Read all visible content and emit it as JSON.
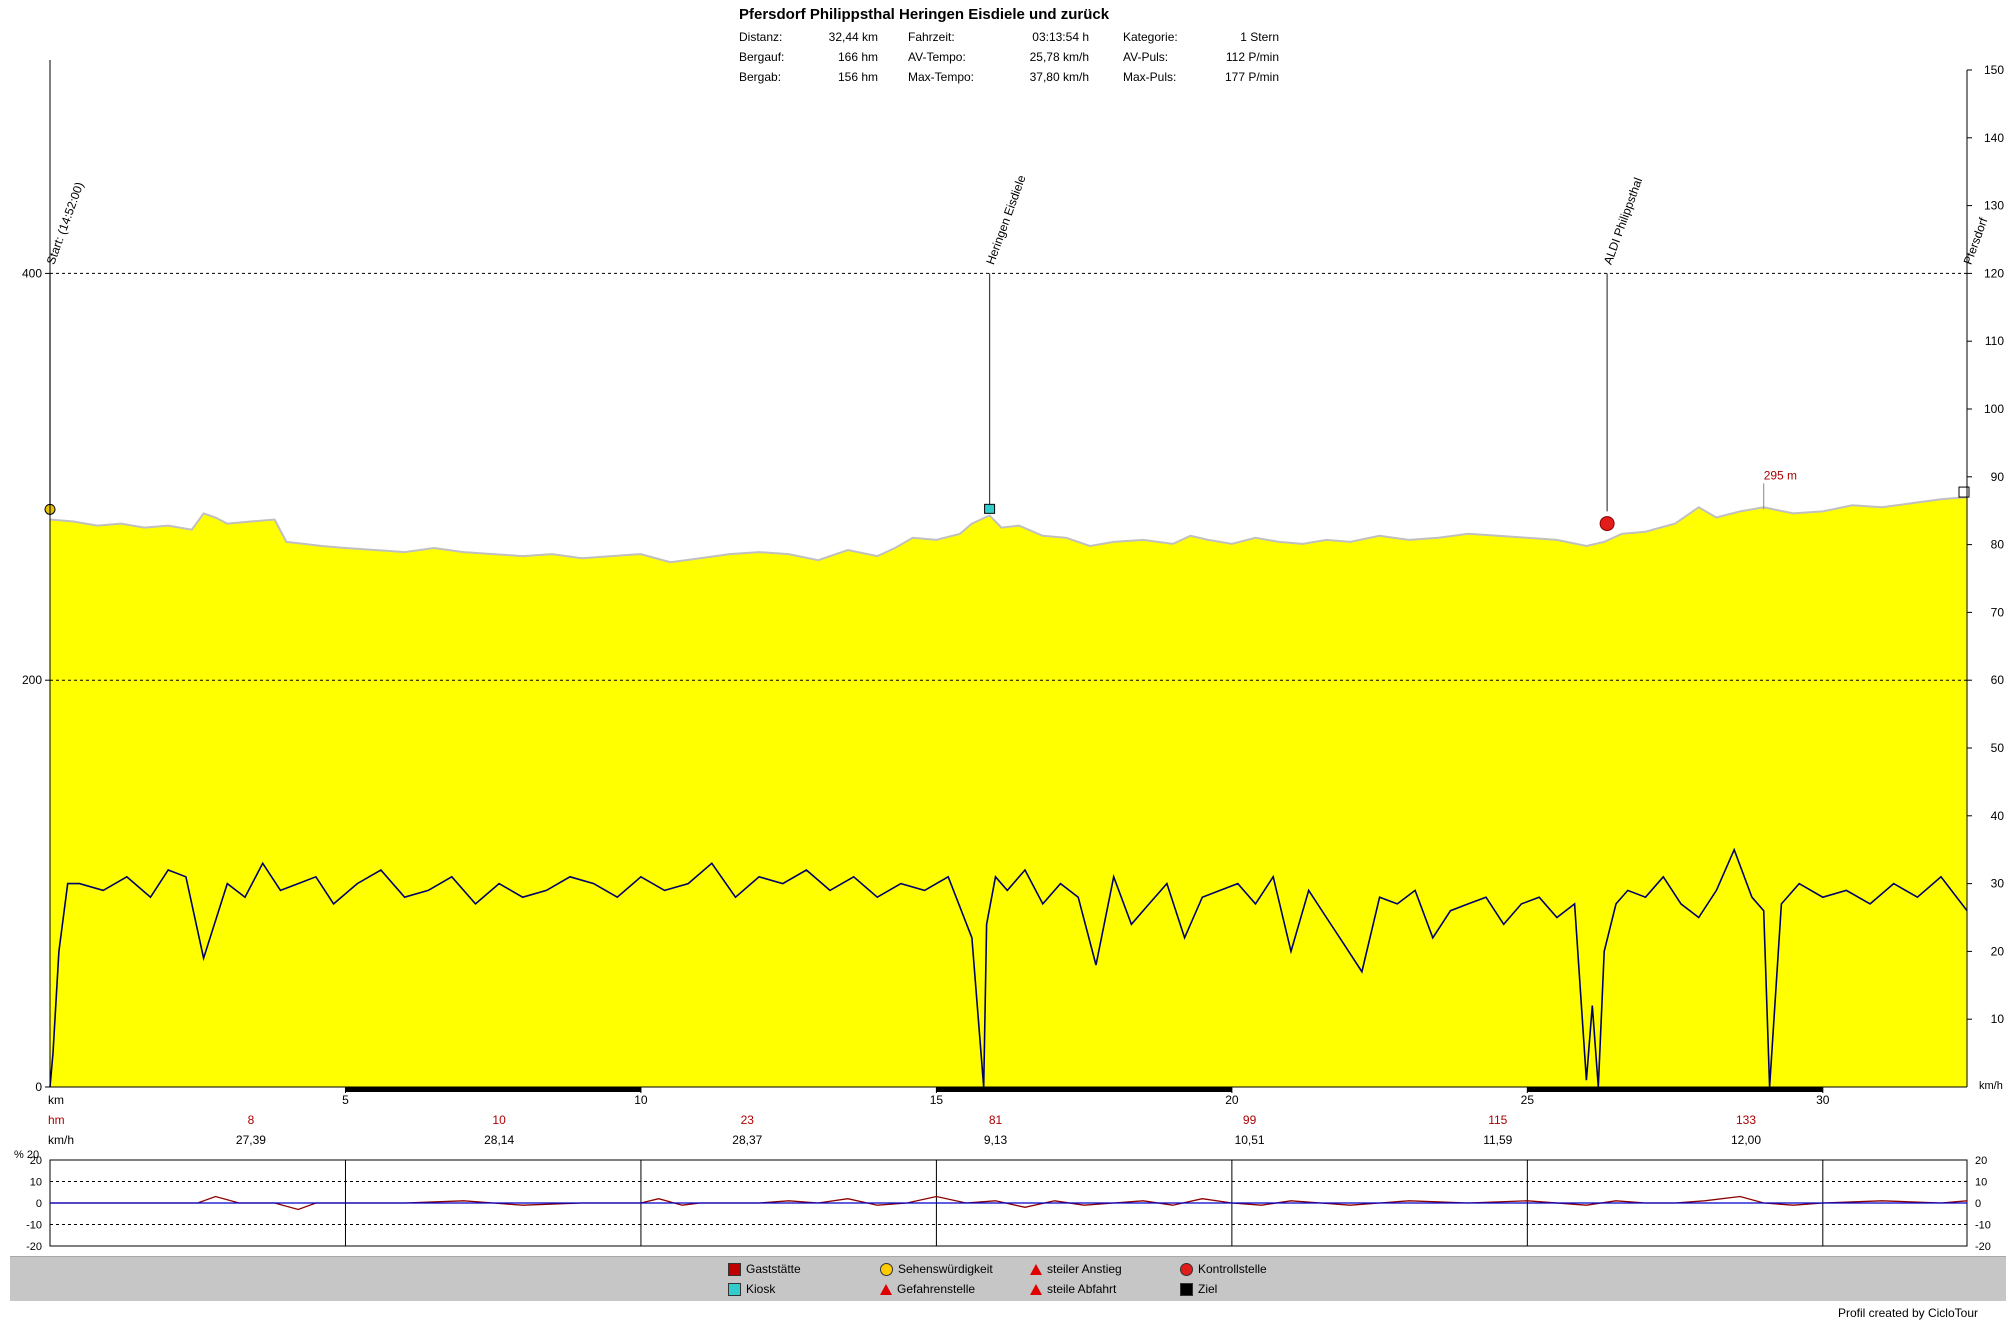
{
  "header": {
    "title": "Pfersdorf Philippsthal Heringen Eisdiele und zurück",
    "stats": [
      [
        {
          "label": "Distanz:",
          "value": "32,44 km"
        },
        {
          "label": "Fahrzeit:",
          "value": "03:13:54 h"
        },
        {
          "label": "Kategorie:",
          "value": "1 Stern"
        }
      ],
      [
        {
          "label": "Bergauf:",
          "value": "166 hm"
        },
        {
          "label": "AV-Tempo:",
          "value": "25,78 km/h"
        },
        {
          "label": "AV-Puls:",
          "value": "112 P/min"
        }
      ],
      [
        {
          "label": "Bergab:",
          "value": "156 hm"
        },
        {
          "label": "Max-Tempo:",
          "value": "37,80 km/h"
        },
        {
          "label": "Max-Puls:",
          "value": "177 P/min"
        }
      ]
    ]
  },
  "chart_data": {
    "type": "area",
    "xlim": [
      0,
      32.44
    ],
    "x_ticks": [
      5,
      10,
      15,
      20,
      25,
      30
    ],
    "x_unit_label": "km",
    "left_axis": {
      "ylim": [
        0,
        500
      ],
      "ticks": [
        0,
        200,
        400
      ]
    },
    "right_axis": {
      "ylim": [
        0,
        150
      ],
      "ticks": [
        10,
        20,
        30,
        40,
        50,
        60,
        70,
        80,
        90,
        100,
        110,
        120,
        130,
        140,
        150
      ],
      "unit_label": "km/h"
    },
    "gridlines_left": [
      200,
      400
    ],
    "elevation": {
      "color": "#ffff00",
      "x": [
        0,
        0.4,
        0.8,
        1.2,
        1.6,
        2.0,
        2.4,
        2.6,
        2.8,
        3.0,
        3.4,
        3.8,
        4.0,
        4.3,
        4.6,
        5.0,
        5.5,
        6.0,
        6.5,
        7.0,
        7.5,
        8.0,
        8.5,
        9.0,
        9.5,
        10.0,
        10.5,
        11.0,
        11.5,
        12.0,
        12.5,
        13.0,
        13.5,
        14.0,
        14.3,
        14.6,
        15.0,
        15.4,
        15.6,
        15.9,
        16.1,
        16.4,
        16.8,
        17.2,
        17.6,
        18.0,
        18.5,
        19.0,
        19.3,
        19.6,
        20.0,
        20.4,
        20.8,
        21.2,
        21.6,
        22.0,
        22.5,
        23.0,
        23.5,
        24.0,
        24.5,
        25.0,
        25.5,
        26.0,
        26.3,
        26.6,
        27.0,
        27.5,
        27.9,
        28.2,
        28.6,
        29.0,
        29.5,
        30.0,
        30.5,
        31.0,
        31.5,
        32.0,
        32.44
      ],
      "y": [
        279,
        278,
        276,
        277,
        275,
        276,
        274,
        282,
        280,
        277,
        278,
        279,
        268,
        267,
        266,
        265,
        264,
        263,
        265,
        263,
        262,
        261,
        262,
        260,
        261,
        262,
        258,
        260,
        262,
        263,
        262,
        259,
        264,
        261,
        265,
        270,
        269,
        272,
        277,
        281,
        275,
        276,
        271,
        270,
        266,
        268,
        269,
        267,
        271,
        269,
        267,
        270,
        268,
        267,
        269,
        268,
        271,
        269,
        270,
        272,
        271,
        270,
        269,
        266,
        268,
        272,
        273,
        277,
        285,
        280,
        283,
        285,
        282,
        283,
        286,
        285,
        287,
        289,
        290
      ]
    },
    "elevation_label": {
      "text": "295 m",
      "x": 29.0,
      "y": 284
    },
    "speed": {
      "color": "#000080",
      "x": [
        0.0,
        0.05,
        0.15,
        0.3,
        0.5,
        0.9,
        1.3,
        1.7,
        2.0,
        2.3,
        2.6,
        3.0,
        3.3,
        3.6,
        3.9,
        4.2,
        4.5,
        4.8,
        5.2,
        5.6,
        6.0,
        6.4,
        6.8,
        7.2,
        7.6,
        8.0,
        8.4,
        8.8,
        9.2,
        9.6,
        10.0,
        10.4,
        10.8,
        11.2,
        11.6,
        12.0,
        12.4,
        12.8,
        13.2,
        13.6,
        14.0,
        14.4,
        14.8,
        15.2,
        15.6,
        15.8,
        15.85,
        16.0,
        16.2,
        16.5,
        16.8,
        17.1,
        17.4,
        17.7,
        18.0,
        18.3,
        18.6,
        18.9,
        19.2,
        19.5,
        19.8,
        20.1,
        20.4,
        20.7,
        21.0,
        21.3,
        21.6,
        21.9,
        22.2,
        22.5,
        22.8,
        23.1,
        23.4,
        23.7,
        24.0,
        24.3,
        24.6,
        24.9,
        25.2,
        25.5,
        25.8,
        26.0,
        26.1,
        26.2,
        26.3,
        26.5,
        26.7,
        27.0,
        27.3,
        27.6,
        27.9,
        28.2,
        28.5,
        28.8,
        29.0,
        29.1,
        29.3,
        29.6,
        30.0,
        30.4,
        30.8,
        31.2,
        31.6,
        32.0,
        32.44
      ],
      "y": [
        0,
        5,
        20,
        30,
        30,
        29,
        31,
        28,
        32,
        31,
        19,
        30,
        28,
        33,
        29,
        30,
        31,
        27,
        30,
        32,
        28,
        29,
        31,
        27,
        30,
        28,
        29,
        31,
        30,
        28,
        31,
        29,
        30,
        33,
        28,
        31,
        30,
        32,
        29,
        31,
        28,
        30,
        29,
        31,
        22,
        0,
        24,
        31,
        29,
        32,
        27,
        30,
        28,
        18,
        31,
        24,
        27,
        30,
        22,
        28,
        29,
        30,
        27,
        31,
        20,
        29,
        25,
        21,
        17,
        28,
        27,
        29,
        22,
        26,
        27,
        28,
        24,
        27,
        28,
        25,
        27,
        1,
        12,
        0,
        20,
        27,
        29,
        28,
        31,
        27,
        25,
        29,
        35,
        28,
        26,
        0,
        27,
        30,
        28,
        29,
        27,
        30,
        28,
        31,
        26
      ]
    },
    "waypoints": [
      {
        "label": "Start: (14:52:00)",
        "x": 0.0
      },
      {
        "label": "Heringen Eisdiele",
        "x": 15.9
      },
      {
        "label": "ALDI Philippsthal",
        "x": 26.35
      },
      {
        "label": "Pfersdorf",
        "x": 32.44
      }
    ],
    "stats_rows": {
      "hm_label": "hm",
      "hm": [
        {
          "x": 3.4,
          "v": "8"
        },
        {
          "x": 7.6,
          "v": "10"
        },
        {
          "x": 11.8,
          "v": "23"
        },
        {
          "x": 16.0,
          "v": "81"
        },
        {
          "x": 20.3,
          "v": "99"
        },
        {
          "x": 24.5,
          "v": "115"
        },
        {
          "x": 28.7,
          "v": "133"
        }
      ],
      "kmh_label": "km/h",
      "kmh": [
        {
          "x": 3.4,
          "v": "27,39"
        },
        {
          "x": 7.6,
          "v": "28,14"
        },
        {
          "x": 11.8,
          "v": "28,37"
        },
        {
          "x": 16.0,
          "v": "9,13"
        },
        {
          "x": 20.3,
          "v": "10,51"
        },
        {
          "x": 24.5,
          "v": "11,59"
        },
        {
          "x": 28.7,
          "v": "12,00"
        }
      ]
    },
    "gradient": {
      "unit_label": "% 20",
      "ylim": [
        -20,
        20
      ],
      "ticks": [
        20,
        10,
        0,
        -10,
        -20
      ],
      "x": [
        0,
        1,
        2,
        2.5,
        2.8,
        3.2,
        3.8,
        4.2,
        4.5,
        5,
        6,
        7,
        7.5,
        8,
        9,
        10,
        10.3,
        10.7,
        11,
        12,
        12.5,
        13,
        13.5,
        14,
        14.5,
        15,
        15.5,
        16,
        16.5,
        17,
        17.5,
        18,
        18.5,
        19,
        19.5,
        20,
        20.5,
        21,
        21.5,
        22,
        22.5,
        23,
        24,
        25,
        26,
        26.5,
        27,
        27.5,
        28,
        28.6,
        29,
        29.5,
        30,
        31,
        32,
        32.44
      ],
      "y": [
        0,
        0,
        0,
        0,
        3,
        0,
        0,
        -3,
        0,
        0,
        0,
        1,
        0,
        -1,
        0,
        0,
        2,
        -1,
        0,
        0,
        1,
        0,
        2,
        -1,
        0,
        3,
        0,
        1,
        -2,
        1,
        -1,
        0,
        1,
        -1,
        2,
        0,
        -1,
        1,
        0,
        -1,
        0,
        1,
        0,
        1,
        -1,
        1,
        0,
        0,
        1,
        3,
        0,
        -1,
        0,
        1,
        0,
        1
      ]
    }
  },
  "legend": {
    "items": [
      {
        "icon": "house-icon",
        "label": "Gaststätte"
      },
      {
        "icon": "kiosk-icon",
        "label": "Kiosk"
      },
      {
        "icon": "smiley-icon",
        "label": "Sehenswürdigkeit"
      },
      {
        "icon": "warning-icon",
        "label": "Gefahrenstelle"
      },
      {
        "icon": "steep-climb-icon",
        "label": "steiler Anstieg"
      },
      {
        "icon": "steep-descent-icon",
        "label": "steile Abfahrt"
      },
      {
        "icon": "stop-icon",
        "label": "Kontrollstelle"
      },
      {
        "icon": "finish-flag-icon",
        "label": "Ziel"
      }
    ]
  },
  "credit": "Profil created by CicloTour"
}
